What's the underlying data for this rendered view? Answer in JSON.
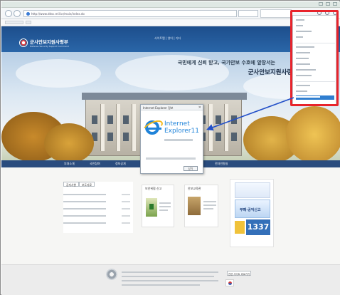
{
  "browser": {
    "address": "http://www.ddsc.mil.kr/main/index.do",
    "about_dialog": {
      "title": "Internet Explorer 정보",
      "close_glyph": "✕",
      "product_line1": "Internet",
      "product_line2": "Explorer11",
      "ok_label": "닫기"
    },
    "tools_menu": {
      "items": [
        "인쇄",
        "파일",
        "확대/축소(100%)",
        "안전",
        "",
        "호환성 보기 설정",
        "알림 및 관리",
        "F12 개발자 도구",
        "고정된 사이트",
        "",
        "인터넷 옵션",
        "Internet Explorer 정보"
      ],
      "highlighted": "Internet Explorer 정보"
    }
  },
  "site": {
    "logo_name": "군사안보지원사령부",
    "logo_sub": "Defense Security Support Command",
    "top_links": "사이트맵 | 영어 | 기타",
    "slogan_line1": "국민에게 신뢰 받고, 국가안보 수호에 앞장서는",
    "slogan_line2": "군사안보지원사령부",
    "menu": [
      "부대소개",
      "국민참여",
      "정보공개",
      "알림마당",
      "민원신청",
      "전자민원",
      "전자민원실",
      "고객참여공간",
      "전자민원창구"
    ],
    "news_tabs": [
      "공지사항",
      "보도자료"
    ],
    "banner1_title": "보안위협 신고",
    "banner2_title": "안보교육관",
    "promo_text": "부패·공익신고",
    "promo_number": "1337",
    "footer_select": "관련 사이트 바로가기"
  },
  "colors": {
    "highlight_border": "#e8232b",
    "arrow": "#2350c8",
    "ie_blue": "#1f83d9",
    "header_blue": "#1d4e8c"
  }
}
